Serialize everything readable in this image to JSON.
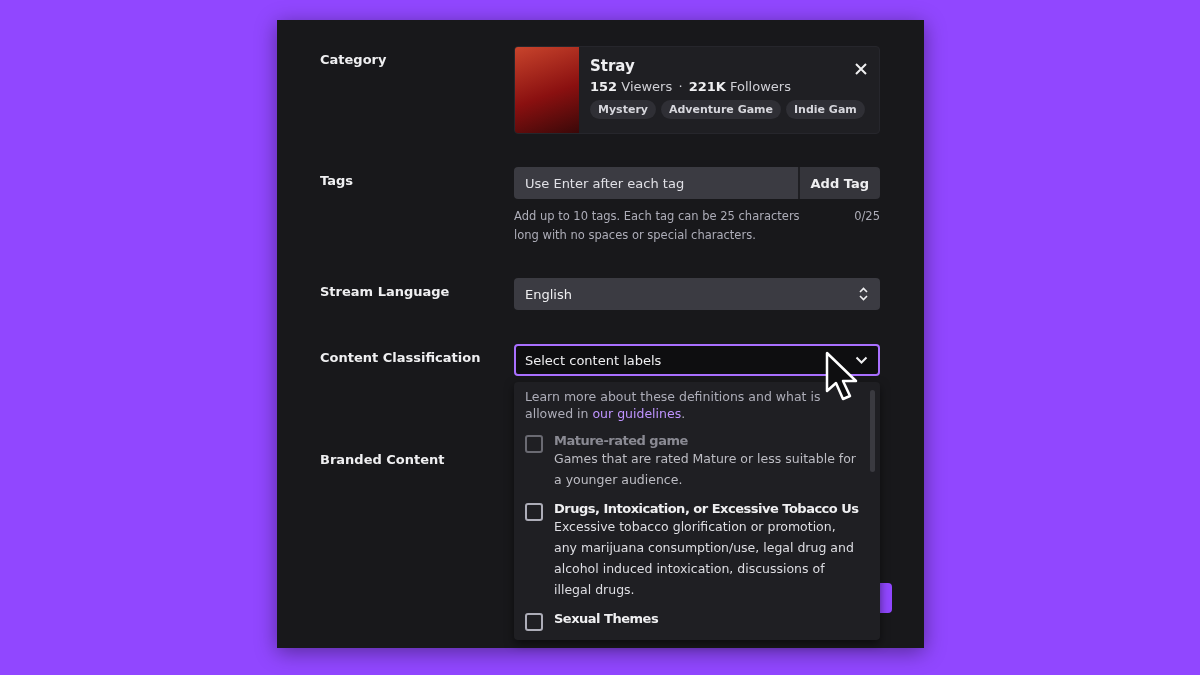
{
  "category": {
    "label": "Category",
    "game": {
      "title": "Stray",
      "viewers_count": "152",
      "viewers_label": "Viewers",
      "separator": "·",
      "followers_count": "221K",
      "followers_label": "Followers",
      "tags": [
        "Mystery",
        "Adventure Game",
        "Indie Gam"
      ]
    }
  },
  "tags": {
    "label": "Tags",
    "placeholder": "Use Enter after each tag",
    "button": "Add Tag",
    "help": "Add up to 10 tags. Each tag can be 25 characters long with no spaces or special characters.",
    "counter": "0/25"
  },
  "language": {
    "label": "Stream Language",
    "value": "English"
  },
  "classification": {
    "label": "Content Classification",
    "placeholder": "Select content labels",
    "expanded": true,
    "intro": "Learn more about these definitions and what is allowed in",
    "link": "our guidelines",
    "intro_end": ".",
    "options": [
      {
        "title": "Mature-rated game",
        "description": "Games that are rated Mature or less suitable for a younger audience.",
        "checked": false,
        "disabled": true
      },
      {
        "title": "Drugs, Intoxication, or Excessive Tobacco Us",
        "description": "Excessive tobacco glorification or promotion, any marijuana consumption/use, legal drug and alcohol induced intoxication, discussions of illegal drugs.",
        "checked": false,
        "disabled": false
      },
      {
        "title": "Sexual Themes",
        "checked": false,
        "disabled": false
      }
    ]
  },
  "branded": {
    "label": "Branded Content"
  }
}
